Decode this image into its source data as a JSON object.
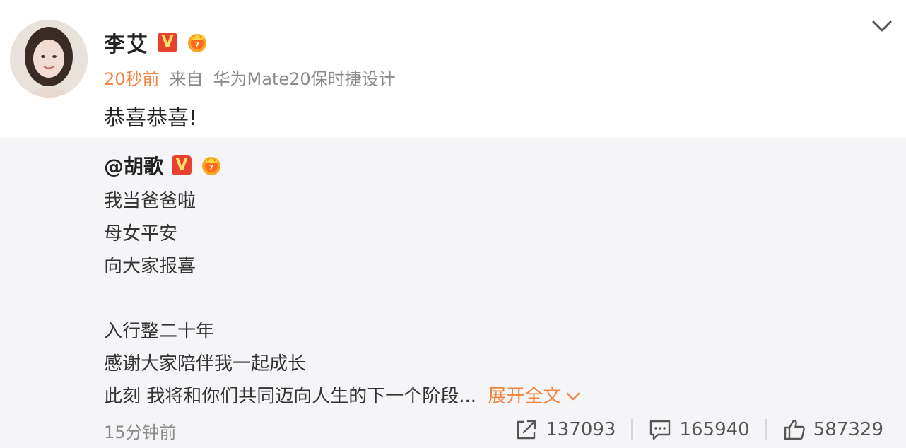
{
  "post": {
    "author": "李艾",
    "v_badge": "V",
    "time": "20秒前",
    "source_prefix": "来自",
    "source": "华为Mate20保时捷设计",
    "text": "恭喜恭喜!"
  },
  "repost": {
    "author": "@胡歌",
    "v_badge": "V",
    "lines": [
      "我当爸爸啦",
      "母女平安",
      "向大家报喜",
      "",
      "入行整二十年",
      "感谢大家陪伴我一起成长",
      "此刻 我将和你们共同迈向人生的下一个阶段..."
    ],
    "expand_label": "展开全文",
    "time": "15分钟前",
    "actions": {
      "share_count": "137093",
      "comment_count": "165940",
      "like_count": "587329"
    }
  },
  "colors": {
    "accent": "#f08541",
    "badge_red": "#e8412f",
    "repost_bg": "#f5f5f8",
    "muted_text": "#8a8a8a"
  },
  "icons": {
    "more": "chevron-down-icon",
    "share": "share-icon",
    "comment": "comment-icon",
    "like": "thumbs-up-icon"
  }
}
